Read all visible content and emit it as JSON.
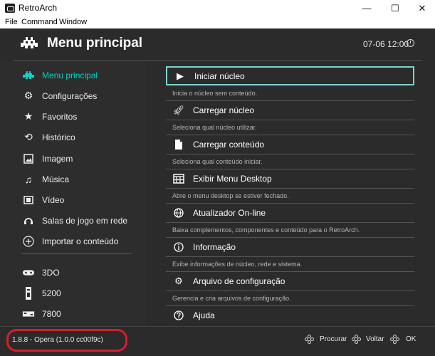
{
  "window": {
    "title": "RetroArch",
    "minimize": "—",
    "maximize": "☐",
    "close": "✕"
  },
  "menubar": [
    "File",
    "Command",
    "Window"
  ],
  "header": {
    "title": "Menu principal",
    "clock": "07-06 12:00"
  },
  "sidebar": {
    "items": [
      {
        "label": "Menu principal",
        "icon": "invader-icon",
        "active": true
      },
      {
        "label": "Configurações",
        "icon": "gear-icon"
      },
      {
        "label": "Favoritos",
        "icon": "star-icon"
      },
      {
        "label": "Histórico",
        "icon": "history-icon"
      },
      {
        "label": "Imagem",
        "icon": "image-icon"
      },
      {
        "label": "Música",
        "icon": "music-icon"
      },
      {
        "label": "Vídeo",
        "icon": "video-icon"
      },
      {
        "label": "Salas de jogo em rede",
        "icon": "netplay-icon"
      },
      {
        "label": "Importar o conteúdo",
        "icon": "plus-icon"
      }
    ],
    "consoles": [
      {
        "label": "3DO",
        "icon": "console-3do-icon"
      },
      {
        "label": "5200",
        "icon": "console-5200-icon"
      },
      {
        "label": "7800",
        "icon": "console-7800-icon"
      }
    ]
  },
  "entries": [
    {
      "label": "Iniciar núcleo",
      "sub": "Inicia o núcleo sem conteúdo.",
      "icon": "play-icon"
    },
    {
      "label": "Carregar núcleo",
      "sub": "Seleciona qual núcleo utilizar.",
      "icon": "rocket-icon"
    },
    {
      "label": "Carregar conteúdo",
      "sub": "Seleciona qual conteúdo iniciar.",
      "icon": "file-icon"
    },
    {
      "label": "Exibir Menu Desktop",
      "sub": "Abre o menu desktop se estiver fechado.",
      "icon": "desktop-icon"
    },
    {
      "label": "Atualizador On-line",
      "sub": "Baixa complementos, componentes e conteúdo para o RetroArch.",
      "icon": "globe-icon"
    },
    {
      "label": "Informação",
      "sub": "Exibe informações de núcleo, rede e sistema.",
      "icon": "info-icon"
    },
    {
      "label": "Arquivo de configuração",
      "sub": "Gerencia e cria arquivos de configuração.",
      "icon": "settings-file-icon"
    },
    {
      "label": "Ajuda",
      "sub": "",
      "icon": "help-icon"
    }
  ],
  "footer": {
    "version": "1.8.8 - Opera (1.0.0 cc00f9c)",
    "hints": [
      "Procurar",
      "Voltar",
      "OK"
    ]
  },
  "colors": {
    "accent": "#00d6c4",
    "background": "#2b2b2b",
    "highlight_ring": "#d81c2c"
  }
}
